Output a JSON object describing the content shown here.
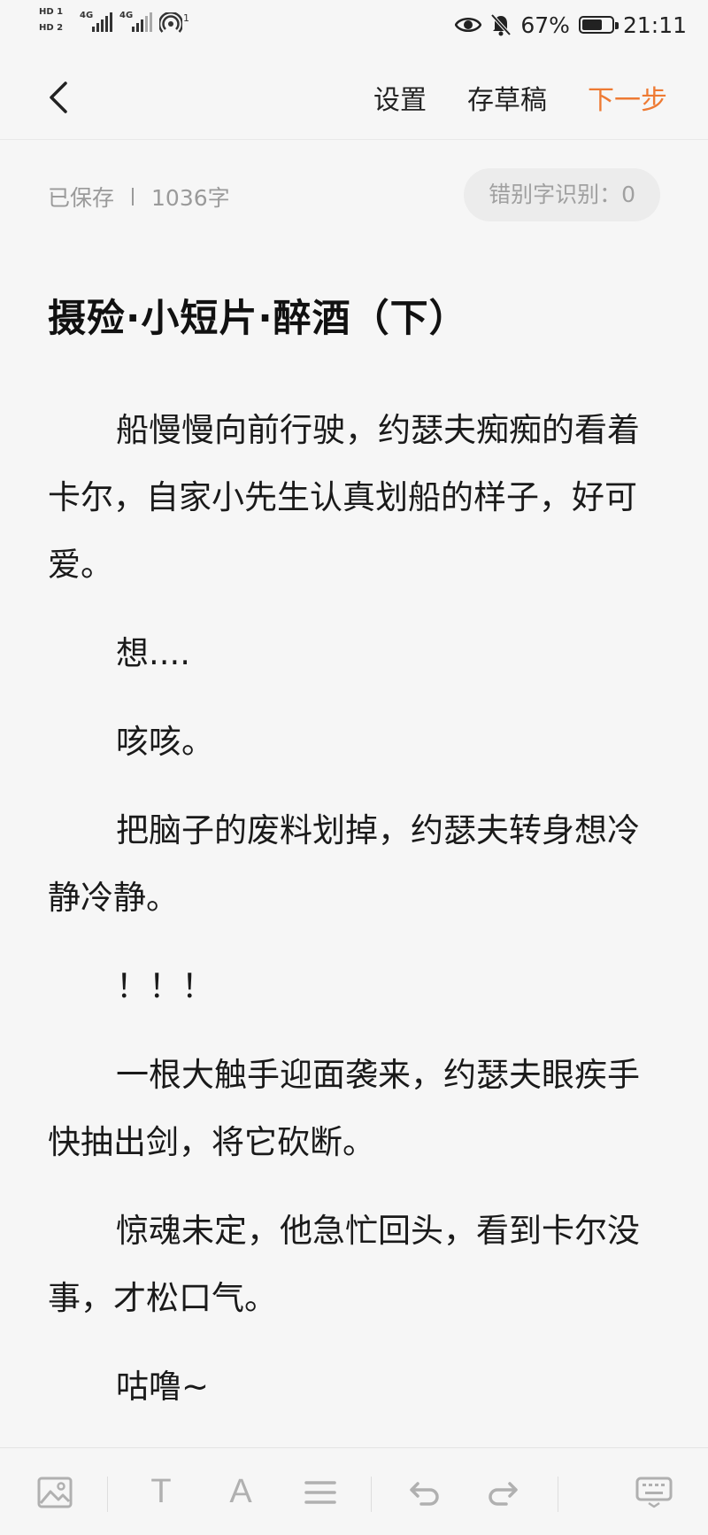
{
  "status_bar": {
    "sim1": "HD 1",
    "sim2": "HD 2",
    "net1": "4G",
    "net2": "4G",
    "hotspot_count": "1",
    "battery": "67%",
    "time": "21:11"
  },
  "nav": {
    "settings": "设置",
    "save_draft": "存草稿",
    "next_step": "下一步",
    "accent_color": "#ee7a33"
  },
  "meta": {
    "saved": "已保存",
    "word_count": "1036字",
    "typo_check": "错别字识别：0"
  },
  "document": {
    "title": "摄殓·小短片·醉酒（下）",
    "paragraphs": [
      "船慢慢向前行驶，约瑟夫痴痴的看着卡尔，自家小先生认真划船的样子，好可爱。",
      "想....",
      "咳咳。",
      "把脑子的废料划掉，约瑟夫转身想冷静冷静。",
      "！！！",
      "一根大触手迎面袭来，约瑟夫眼疾手快抽出剑，将它砍断。",
      "惊魂未定，他急忙回头，看到卡尔没事，才松口气。",
      "咕噜~"
    ]
  },
  "toolbar": {
    "text_tool": "T",
    "font_tool": "A",
    "icons": [
      "image-icon",
      "text-style-icon",
      "font-icon",
      "align-icon",
      "undo-icon",
      "redo-icon",
      "keyboard-icon"
    ]
  }
}
